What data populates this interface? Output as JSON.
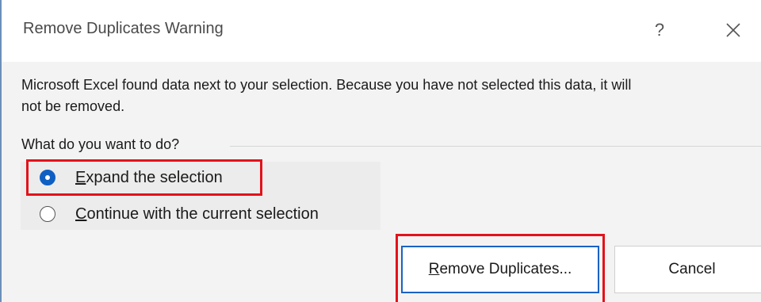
{
  "dialog": {
    "title": "Remove Duplicates Warning",
    "help_symbol": "?",
    "close_icon": "close-icon"
  },
  "message": {
    "line1": "Microsoft Excel found data next to your selection. Because you have not selected this data, it will",
    "line2": "not be removed."
  },
  "options_group": {
    "label": "What do you want to do?",
    "options": [
      {
        "accel": "E",
        "rest": "xpand the selection",
        "checked": true
      },
      {
        "accel": "C",
        "rest": "ontinue with the current selection",
        "checked": false
      }
    ]
  },
  "buttons": {
    "primary": {
      "accel": "R",
      "rest": "emove Duplicates..."
    },
    "cancel": "Cancel"
  },
  "colors": {
    "highlight": "#e3121b",
    "accent": "#0f5fc3"
  }
}
